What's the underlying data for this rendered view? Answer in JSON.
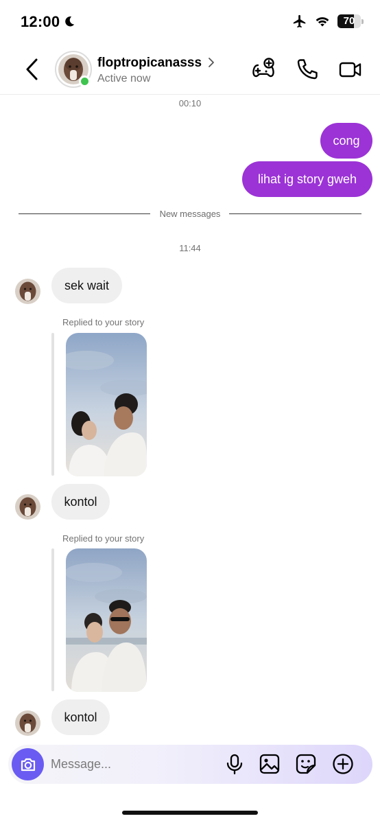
{
  "status_bar": {
    "time": "12:00",
    "battery_level": 70,
    "battery_text": "70",
    "icons": [
      "moon-icon",
      "airplane-icon",
      "wifi-icon",
      "battery-icon"
    ]
  },
  "header": {
    "username": "floptropicanasss",
    "status": "Active now",
    "icons": [
      "back-chevron-icon",
      "chevron-right-icon",
      "games-icon",
      "phone-icon",
      "video-icon"
    ],
    "online_color": "#3fc44f"
  },
  "messages": {
    "timestamp_1": "00:10",
    "outgoing": [
      {
        "text": "cong"
      },
      {
        "text": "lihat ig story gweh"
      }
    ],
    "new_messages_label": "New messages",
    "timestamp_2": "11:44",
    "incoming": [
      {
        "text": "sek wait"
      },
      {
        "text": "kontol"
      },
      {
        "text": "kontol"
      }
    ],
    "reply_labels": [
      "Replied to your story",
      "Replied to your story"
    ],
    "story_1_caption": "",
    "story_2_caption": "",
    "outgoing_color": "#9b33d6",
    "incoming_color": "#efefef"
  },
  "composer": {
    "placeholder": "Message...",
    "value": "",
    "icons": [
      "camera-icon",
      "microphone-icon",
      "gallery-icon",
      "sticker-icon",
      "add-icon"
    ],
    "accent": "#6a5cf2"
  }
}
